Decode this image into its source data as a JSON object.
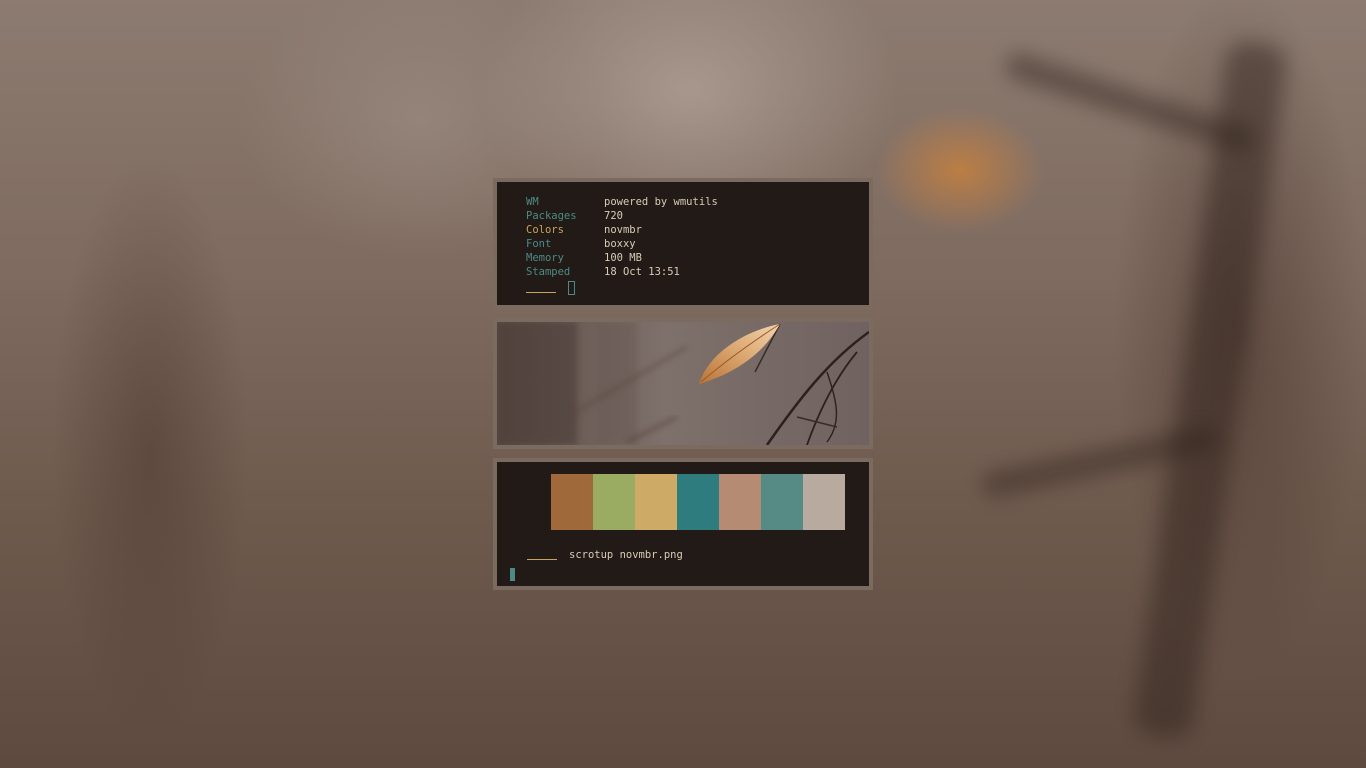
{
  "info_panel": {
    "rows": [
      {
        "key": "WM",
        "value": "powered by wmutils"
      },
      {
        "key": "Packages",
        "value": "720"
      },
      {
        "key": "Colors",
        "value": "novmbr"
      },
      {
        "key": "Font",
        "value": "boxxy"
      },
      {
        "key": "Memory",
        "value": "100 MB"
      },
      {
        "key": "Stamped",
        "value": "18 Oct 13:51"
      }
    ]
  },
  "palette_panel": {
    "colors": [
      "#221a16",
      "#a0693a",
      "#9aac62",
      "#cdaa66",
      "#2f7c7f",
      "#b68b74",
      "#568a85",
      "#b8aa9f"
    ],
    "command": "scrotup novmbr.png"
  },
  "theme": {
    "accent_gold": "#c9a25f",
    "accent_teal": "#4d8a86",
    "panel_bg": "#211a16",
    "text": "#d9cbb6"
  }
}
